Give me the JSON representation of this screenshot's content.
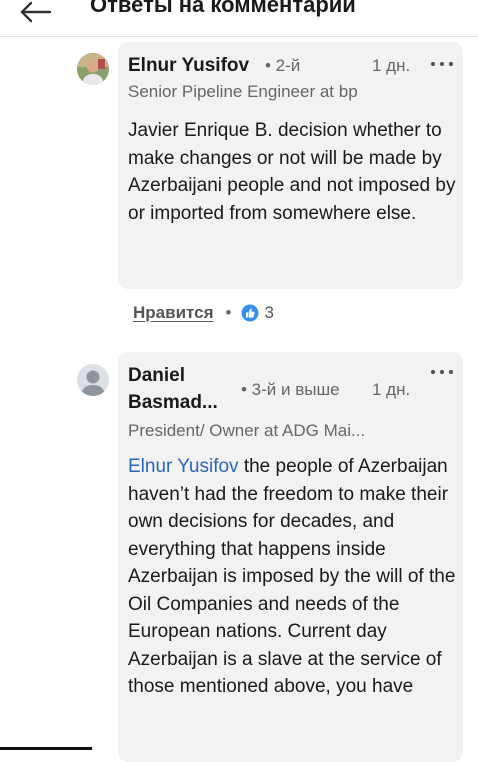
{
  "header": {
    "title": "Ответы на комментарий",
    "back_icon": "arrow-left-icon"
  },
  "comments": [
    {
      "author": "Elnur Yusifov",
      "degree": "• 2-й",
      "time": "1 дн.",
      "headline": "Senior Pipeline Engineer at bp",
      "mention": "",
      "text": "Javier Enrique B. decision whether to make changes or not will be made by Azerbaijani people and not imposed by or imported from somewhere else.",
      "avatar_icon": "profile-photo-icon",
      "more_icon": "ellipsis-icon",
      "actions": {
        "like_label": "Нравится",
        "separator": "•",
        "reaction_icon": "like-reaction-icon",
        "reaction_count": "3"
      }
    },
    {
      "author_line1": "Daniel",
      "author_line2": "Basmad...",
      "degree": "• 3-й и выше",
      "time": "1 дн.",
      "headline": "President/ Owner at ADG Mai...",
      "mention": "Elnur Yusifov",
      "text": " the people of Azerbaijan haven’t had the freedom to make their own decisions for decades, and everything that happens inside Azerbaijan is imposed by the will of the Oil Companies and needs of the European nations. Current day Azerbaijan is a slave at the service of those mentioned above, you have",
      "avatar_icon": "default-avatar-icon",
      "more_icon": "ellipsis-icon"
    }
  ],
  "colors": {
    "bubble": "#f2f2f2",
    "mention": "#2a66bc",
    "reaction": "#378fe9",
    "text": "#1a1a1a",
    "muted": "#666666"
  }
}
